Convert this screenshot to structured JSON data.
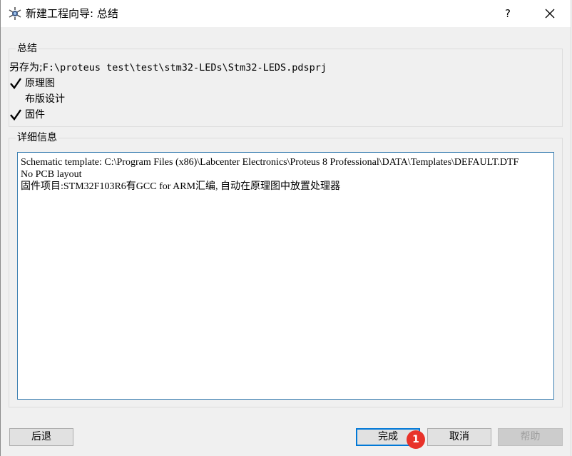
{
  "window": {
    "title": "新建工程向导: 总结",
    "help_glyph": "?",
    "close_icon": "close-icon",
    "app_icon": "proteus-app-icon"
  },
  "summary": {
    "group_label": "总结",
    "save_as_label": "另存为;",
    "save_as_path": "F:\\proteus test\\test\\stm32-LEDs\\Stm32-LEDS.pdsprj",
    "items": [
      {
        "label": "原理图",
        "checked": true
      },
      {
        "label": "布版设计",
        "checked": false
      },
      {
        "label": "固件",
        "checked": true
      }
    ]
  },
  "details": {
    "group_label": "详细信息",
    "text": "Schematic template: C:\\Program Files (x86)\\Labcenter Electronics\\Proteus 8 Professional\\DATA\\Templates\\DEFAULT.DTF\nNo PCB layout\n固件项目:STM32F103R6有GCC for ARM汇编, 自动在原理图中放置处理器"
  },
  "buttons": {
    "back": "后退",
    "finish": "完成",
    "cancel": "取消",
    "help": "帮助"
  },
  "annotation_badge": "1",
  "colors": {
    "focus_border": "#0078d7",
    "badge": "#e8322a",
    "dialog_bg": "#f0f0f0"
  }
}
